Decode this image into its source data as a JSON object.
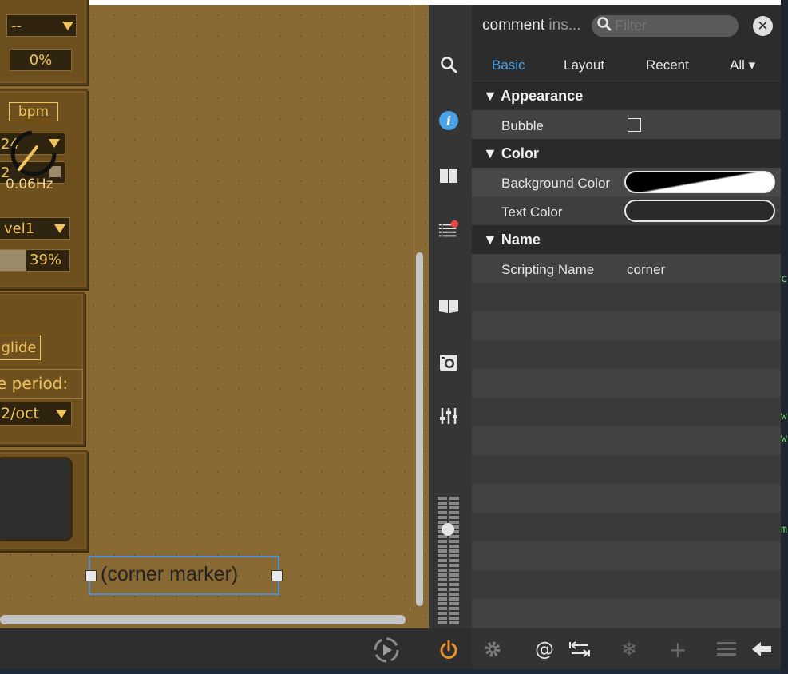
{
  "canvas": {
    "percent_top_label": "0%",
    "dropdown_top": "--",
    "bpm_button": "bpm",
    "dropdown_rate": "24",
    "dropdown_rate2": "2",
    "knob_value": "0.06Hz",
    "vel_dropdown": "vel1",
    "vel_percent": "39%",
    "vel_fill_fraction": 0.39,
    "glide_button": "glide",
    "period_label": "e period:",
    "oct_dropdown": "2/oct",
    "comment_text": "(corner marker)"
  },
  "tools": {
    "search": "search-icon",
    "info": "info-icon",
    "panels": "columns-icon",
    "list": "list-icon",
    "book": "book-icon",
    "camera": "camera-icon",
    "mixer": "mixer-icon",
    "power": "power-icon",
    "accent": "#e8922a",
    "info_color": "#4aa3e8",
    "badge_color": "#e84848"
  },
  "inspector": {
    "title": "comment",
    "title_dim": "ins...",
    "filter_placeholder": "Filter",
    "tabs": [
      {
        "label": "Basic"
      },
      {
        "label": "Layout"
      },
      {
        "label": "Recent"
      },
      {
        "label": "All ▾"
      }
    ],
    "sections": {
      "appearance": "Appearance",
      "color": "Color",
      "name": "Name"
    },
    "props": {
      "bubble": "Bubble",
      "background_color": "Background Color",
      "text_color": "Text Color",
      "scripting_name": "Scripting Name",
      "scripting_name_value": "corner"
    },
    "footer": {
      "gear": "gear-icon",
      "at_symbol": "@",
      "snowflake": "snowflake-icon",
      "plus": "+"
    }
  },
  "right_sliver": {
    "chars": [
      "c",
      "w",
      "w",
      "m"
    ]
  }
}
